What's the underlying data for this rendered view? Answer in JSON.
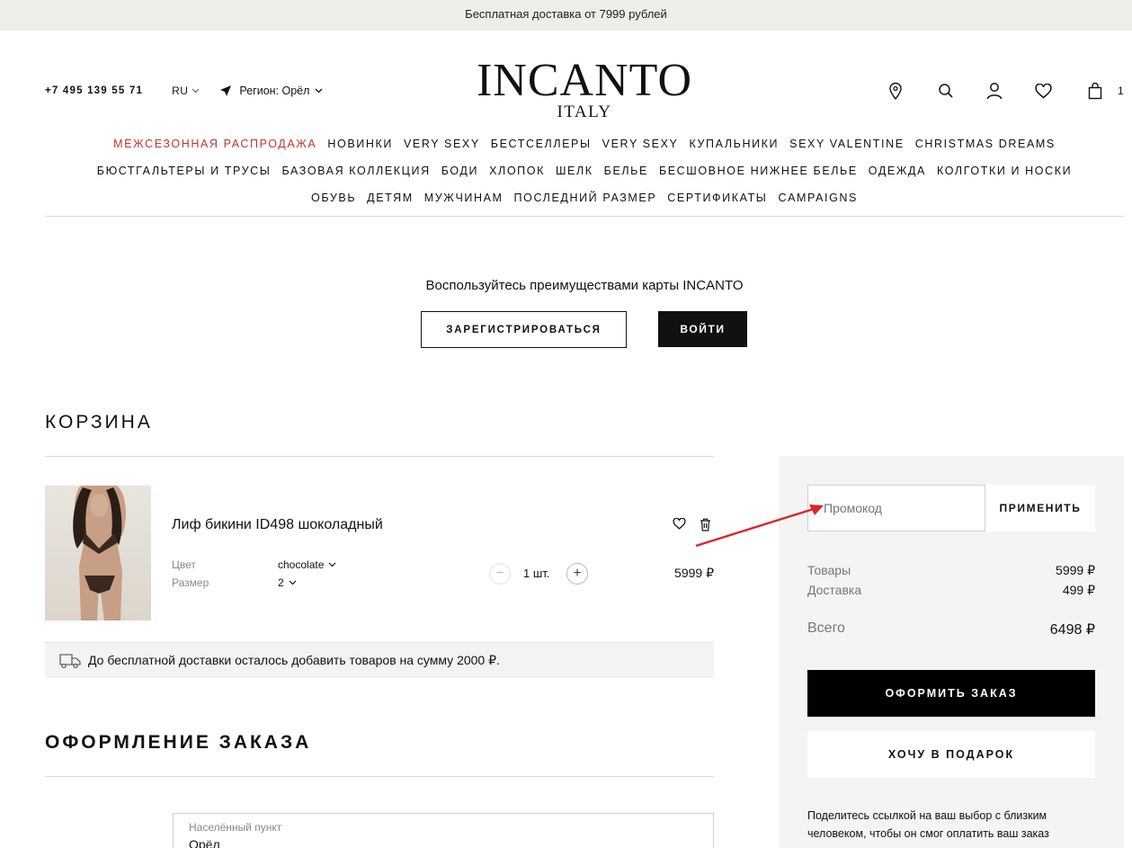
{
  "topbar": {
    "text": "Бесплатная доставка от 7999 рублей"
  },
  "header": {
    "phone": "+7 495 139 55 71",
    "lang": "RU",
    "region": "Регион: Орёл",
    "logo_main": "INCANTO",
    "logo_sub": "ITALY",
    "cart_count": "1",
    "icons": [
      "map-pin-icon",
      "search-icon",
      "user-icon",
      "heart-icon",
      "bag-icon"
    ]
  },
  "nav": {
    "row1": [
      "МЕЖСЕЗОННАЯ РАСПРОДАЖА",
      "НОВИНКИ",
      "VERY SEXY",
      "БЕСТСЕЛЛЕРЫ",
      "VERY SEXY",
      "КУПАЛЬНИКИ",
      "SEXY VALENTINE",
      "CHRISTMAS DREAMS"
    ],
    "row2": [
      "БЮСТГАЛЬТЕРЫ И ТРУСЫ",
      "БАЗОВАЯ КОЛЛЕКЦИЯ",
      "БОДИ",
      "ХЛОПОК",
      "ШЕЛК",
      "БЕЛЬЕ",
      "БЕСШОВНОЕ НИЖНЕЕ БЕЛЬЕ",
      "ОДЕЖДА",
      "КОЛГОТКИ И НОСКИ"
    ],
    "row3": [
      "ОБУВЬ",
      "ДЕТЯМ",
      "МУЖЧИНАМ",
      "ПОСЛЕДНИЙ РАЗМЕР",
      "СЕРТИФИКАТЫ",
      "CAMPAIGNS"
    ],
    "sale_color": "#c2342c"
  },
  "loyalty": {
    "title": "Воспользуйтесь преимуществами карты INCANTO",
    "register": "ЗАРЕГИСТРИРОВАТЬСЯ",
    "login": "ВОЙТИ"
  },
  "cart": {
    "heading": "КОРЗИНА",
    "item": {
      "name": "Лиф бикини ID498 шоколадный",
      "color_label": "Цвет",
      "color_value": "chocolate",
      "size_label": "Размер",
      "size_value": "2",
      "qty": "1 шт.",
      "price": "5999 ₽"
    },
    "free_shipping": "До бесплатной доставки осталось добавить товаров на сумму 2000 ₽."
  },
  "checkout": {
    "heading": "ОФОРМЛЕНИЕ ЗАКАЗА",
    "city_label": "Населённый пункт",
    "city_value": "Орёл"
  },
  "summary": {
    "promo_placeholder": "Промокод",
    "apply": "ПРИМЕНИТЬ",
    "goods_label": "Товары",
    "goods_value": "5999 ₽",
    "delivery_label": "Доставка",
    "delivery_value": "499 ₽",
    "total_label": "Всего",
    "total_value": "6498 ₽",
    "order": "ОФОРМИТЬ ЗАКАЗ",
    "gift": "ХОЧУ В ПОДАРОК",
    "share_text": "Поделитесь ссылкой на ваш выбор с близким человеком, чтобы он смог оплатить ваш заказ"
  }
}
